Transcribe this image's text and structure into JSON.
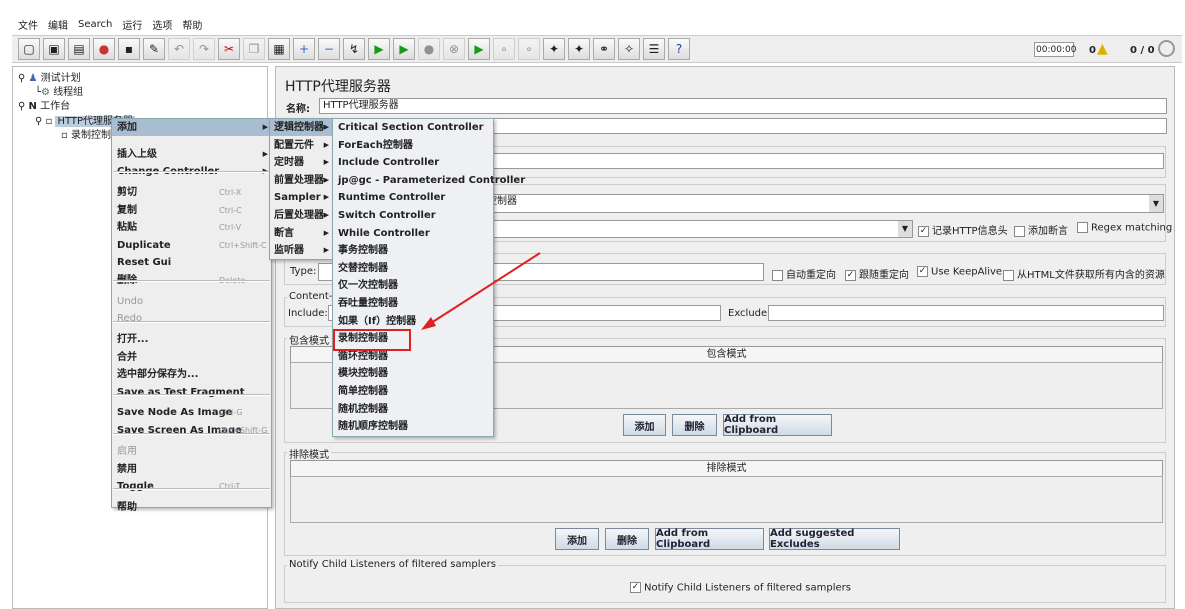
{
  "menubar": [
    "文件",
    "编辑",
    "Search",
    "运行",
    "选项",
    "帮助"
  ],
  "toolbar": {
    "icons": [
      "new-icon",
      "templates-icon",
      "open-icon",
      "close-icon",
      "save-icon",
      "save-as-icon",
      "undo-icon",
      "redo-icon",
      "cut-icon",
      "copy-icon",
      "paste-icon",
      "expand-icon",
      "collapse-icon",
      "toggle-icon",
      "start-icon",
      "start-no-pause-icon",
      "stop-icon",
      "shutdown-icon",
      "remote-start-icon",
      "remote-stop-icon",
      "remote-shutdown-icon",
      "clear-icon",
      "clear-all-icon",
      "search-icon",
      "reset-search-icon",
      "function-helper-icon",
      "help-icon"
    ],
    "timer": "00:00:00",
    "warnings": "0",
    "threads": "0 / 0"
  },
  "tree": {
    "items": [
      "测试计划",
      "线程组",
      "工作台",
      "HTTP代理服务器",
      "录制控制器"
    ]
  },
  "panel": {
    "title": "HTTP代理服务器",
    "name_label": "名称:",
    "name_value": "HTTP代理服务器",
    "target_value": "录制控制器",
    "checks1": [
      {
        "label": "记录HTTP信息头",
        "checked": true
      },
      {
        "label": "添加断言",
        "checked": false
      },
      {
        "label": "Regex matching",
        "checked": false
      }
    ],
    "type_label": "Type:",
    "checks2": [
      {
        "label": "自动重定向",
        "checked": false
      },
      {
        "label": "跟随重定向",
        "checked": true
      },
      {
        "label": "Use KeepAlive",
        "checked": true
      },
      {
        "label": "从HTML文件获取所有内含的资源",
        "checked": false
      }
    ],
    "content_type_title": "Content-type filter",
    "include_label": "Include:",
    "exclude_label": "Exclude:",
    "include_group": "包含模式",
    "include_header": "包含模式",
    "exclude_group": "排除模式",
    "exclude_header": "排除模式",
    "buttons": {
      "add": "添加",
      "delete": "删除",
      "clipboard": "Add from Clipboard",
      "suggested": "Add suggested Excludes"
    },
    "notify_group": "Notify Child Listeners of filtered samplers",
    "notify_check": "Notify Child Listeners of filtered samplers",
    "notify_checked": true
  },
  "context_menu": [
    {
      "label": "添加",
      "arrow": true,
      "highlight": true
    },
    {
      "label": "插入上级",
      "arrow": true
    },
    {
      "label": "Change Controller",
      "arrow": true
    },
    {
      "label": "剪切",
      "shortcut": "Ctrl-X"
    },
    {
      "label": "复制",
      "shortcut": "Ctrl-C"
    },
    {
      "label": "粘贴",
      "shortcut": "Ctrl-V"
    },
    {
      "label": "Duplicate",
      "shortcut": "Ctrl+Shift-C"
    },
    {
      "label": "Reset Gui"
    },
    {
      "label": "删除",
      "shortcut": "Delete"
    },
    {
      "label": "Undo",
      "disabled": true
    },
    {
      "label": "Redo",
      "disabled": true
    },
    {
      "label": "打开..."
    },
    {
      "label": "合并"
    },
    {
      "label": "选中部分保存为..."
    },
    {
      "label": "Save as Test Fragment"
    },
    {
      "label": "Save Node As Image",
      "shortcut": "Ctrl-G"
    },
    {
      "label": "Save Screen As Image",
      "shortcut": "Ctrl+Shift-G"
    },
    {
      "label": "启用",
      "disabled": true
    },
    {
      "label": "禁用"
    },
    {
      "label": "Toggle",
      "shortcut": "Ctrl-T"
    },
    {
      "label": "帮助"
    }
  ],
  "add_submenu": [
    "逻辑控制器",
    "配置元件",
    "定时器",
    "前置处理器",
    "Sampler",
    "后置处理器",
    "断言",
    "监听器"
  ],
  "logic_submenu": [
    "Critical Section Controller",
    "ForEach控制器",
    "Include Controller",
    "jp@gc - Parameterized Controller",
    "Runtime Controller",
    "Switch Controller",
    "While Controller",
    "事务控制器",
    "交替控制器",
    "仅一次控制器",
    "吞吐量控制器",
    "如果（If）控制器",
    "录制控制器",
    "循环控制器",
    "模块控制器",
    "简单控制器",
    "随机控制器",
    "随机顺序控制器"
  ],
  "highlight_color": "#e02020"
}
